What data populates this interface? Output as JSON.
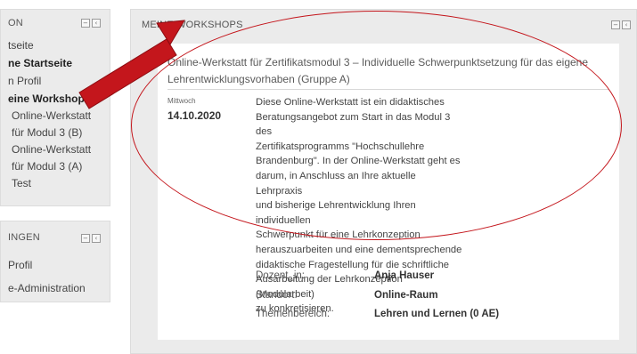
{
  "nav_block": {
    "title": "ON",
    "items": [
      {
        "label": "tseite",
        "bold": false,
        "level": 0
      },
      {
        "label": "ne Startseite",
        "bold": true,
        "level": 0
      },
      {
        "label": "n Profil",
        "bold": false,
        "level": 0
      },
      {
        "label": "eine Workshops",
        "bold": true,
        "level": 0
      },
      {
        "label": "Online-Werkstatt",
        "bold": false,
        "level": 1
      },
      {
        "label": "für Modul 3 (B)",
        "bold": false,
        "level": 1
      },
      {
        "label": "Online-Werkstatt",
        "bold": false,
        "level": 1
      },
      {
        "label": "für Modul 3 (A)",
        "bold": false,
        "level": 1
      },
      {
        "label": "Test",
        "bold": false,
        "level": 1
      }
    ]
  },
  "settings_block": {
    "title": "INGEN",
    "items": [
      {
        "label": "Profil"
      },
      {
        "label": "e-Administration"
      }
    ]
  },
  "controls": {
    "collapse": "−",
    "dock": "‹"
  },
  "main": {
    "title": "MEINE WORKSHOPS",
    "course": {
      "title": "Online-Werkstatt für Zertifikatsmodul 3 – Individuelle Schwerpunktsetzung für das eigene Lehrentwicklungsvorhaben (Gruppe A)",
      "weekday": "Mittwoch",
      "date": "14.10.2020",
      "description_lines": [
        "Diese Online-Werkstatt ist ein didaktisches",
        "Beratungsangebot zum Start in das Modul 3 des",
        "Zertifikatsprogramms \"Hochschullehre",
        "Brandenburg\". In der Online-Werkstatt geht es",
        "darum, in Anschluss an Ihre aktuelle Lehrpraxis",
        "und bisherige Lehrentwicklung Ihren individuellen",
        "Schwerpunkt für eine Lehrkonzeption",
        "herauszuarbeiten und eine dementsprechende",
        "didaktische Fragestellung für die schriftliche",
        "Ausarbeitung der Lehrkonzeption (Modularbeit)",
        "zu konkretisieren."
      ],
      "details": [
        {
          "label": "Dozent_in:",
          "value": "Anja Hauser"
        },
        {
          "label": "Standort:",
          "value": "Online-Raum"
        },
        {
          "label": "Themenbereich:",
          "value": "Lehren und Lernen (0 AE)"
        }
      ]
    }
  },
  "annotation": {
    "color": "#c4161c",
    "arrow_dark": "#8e0d12"
  }
}
